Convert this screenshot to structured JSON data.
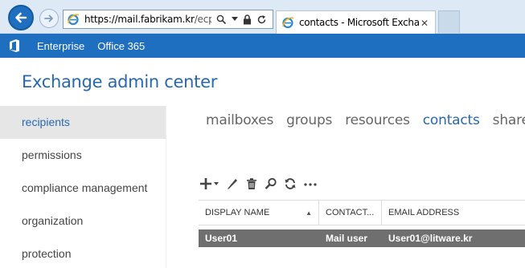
{
  "browser": {
    "url_host": "https://mail.fabrikam.kr",
    "url_path": "/ecp/de",
    "tab_title": "contacts - Microsoft Excha...",
    "tab_close": "✕"
  },
  "topbar": {
    "links": [
      "Enterprise",
      "Office 365"
    ],
    "accent_color": "#1f6fc0"
  },
  "app_title": "Exchange admin center",
  "sidebar": {
    "items": [
      {
        "label": "recipients",
        "active": true
      },
      {
        "label": "permissions",
        "active": false
      },
      {
        "label": "compliance management",
        "active": false
      },
      {
        "label": "organization",
        "active": false
      },
      {
        "label": "protection",
        "active": false
      }
    ]
  },
  "subnav": {
    "tabs": [
      {
        "label": "mailboxes",
        "active": false
      },
      {
        "label": "groups",
        "active": false
      },
      {
        "label": "resources",
        "active": false
      },
      {
        "label": "contacts",
        "active": true
      },
      {
        "label": "shared",
        "active": false
      }
    ]
  },
  "toolbar": {
    "icons": [
      "add-icon",
      "edit-icon",
      "delete-icon",
      "search-icon",
      "refresh-icon",
      "more-icon"
    ]
  },
  "table": {
    "columns": [
      "DISPLAY NAME",
      "CONTACT...",
      "EMAIL ADDRESS"
    ],
    "sort_indicator": "▲",
    "rows": [
      {
        "display_name": "User01",
        "contact_type": "Mail user",
        "email": "User01@litware.kr",
        "selected": true
      }
    ]
  }
}
